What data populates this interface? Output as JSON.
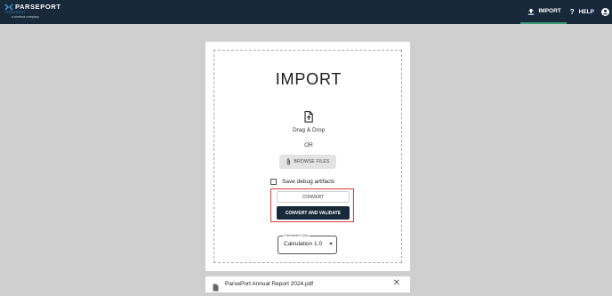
{
  "brand": {
    "name": "PARSEPORT",
    "tagline": "a workiva company"
  },
  "nav": {
    "import_label": "IMPORT",
    "help_label": "HELP",
    "import_icon": "upload-icon",
    "help_icon": "question-icon",
    "account_icon": "account-icon"
  },
  "import_panel": {
    "title": "IMPORT",
    "drag_label": "Drag & Drop",
    "or_label": "OR",
    "browse_label": "BROWSE FILES",
    "debug_label": "Save debug artifacts",
    "debug_checked": false,
    "convert_label": "CONVERT",
    "convert_validate_label": "CONVERT AND VALIDATE",
    "calc_type_label": "Calculation Type",
    "calc_type_value": "Calculation 1.0"
  },
  "file": {
    "name": "ParsePort Annual Report 2024.pdf",
    "close_symbol": "✕"
  },
  "colors": {
    "topbar": "#17283a",
    "accent": "#3a9a73",
    "primary_button": "#18293a",
    "highlight": "#e03b3b",
    "background": "#cfcfcf"
  }
}
